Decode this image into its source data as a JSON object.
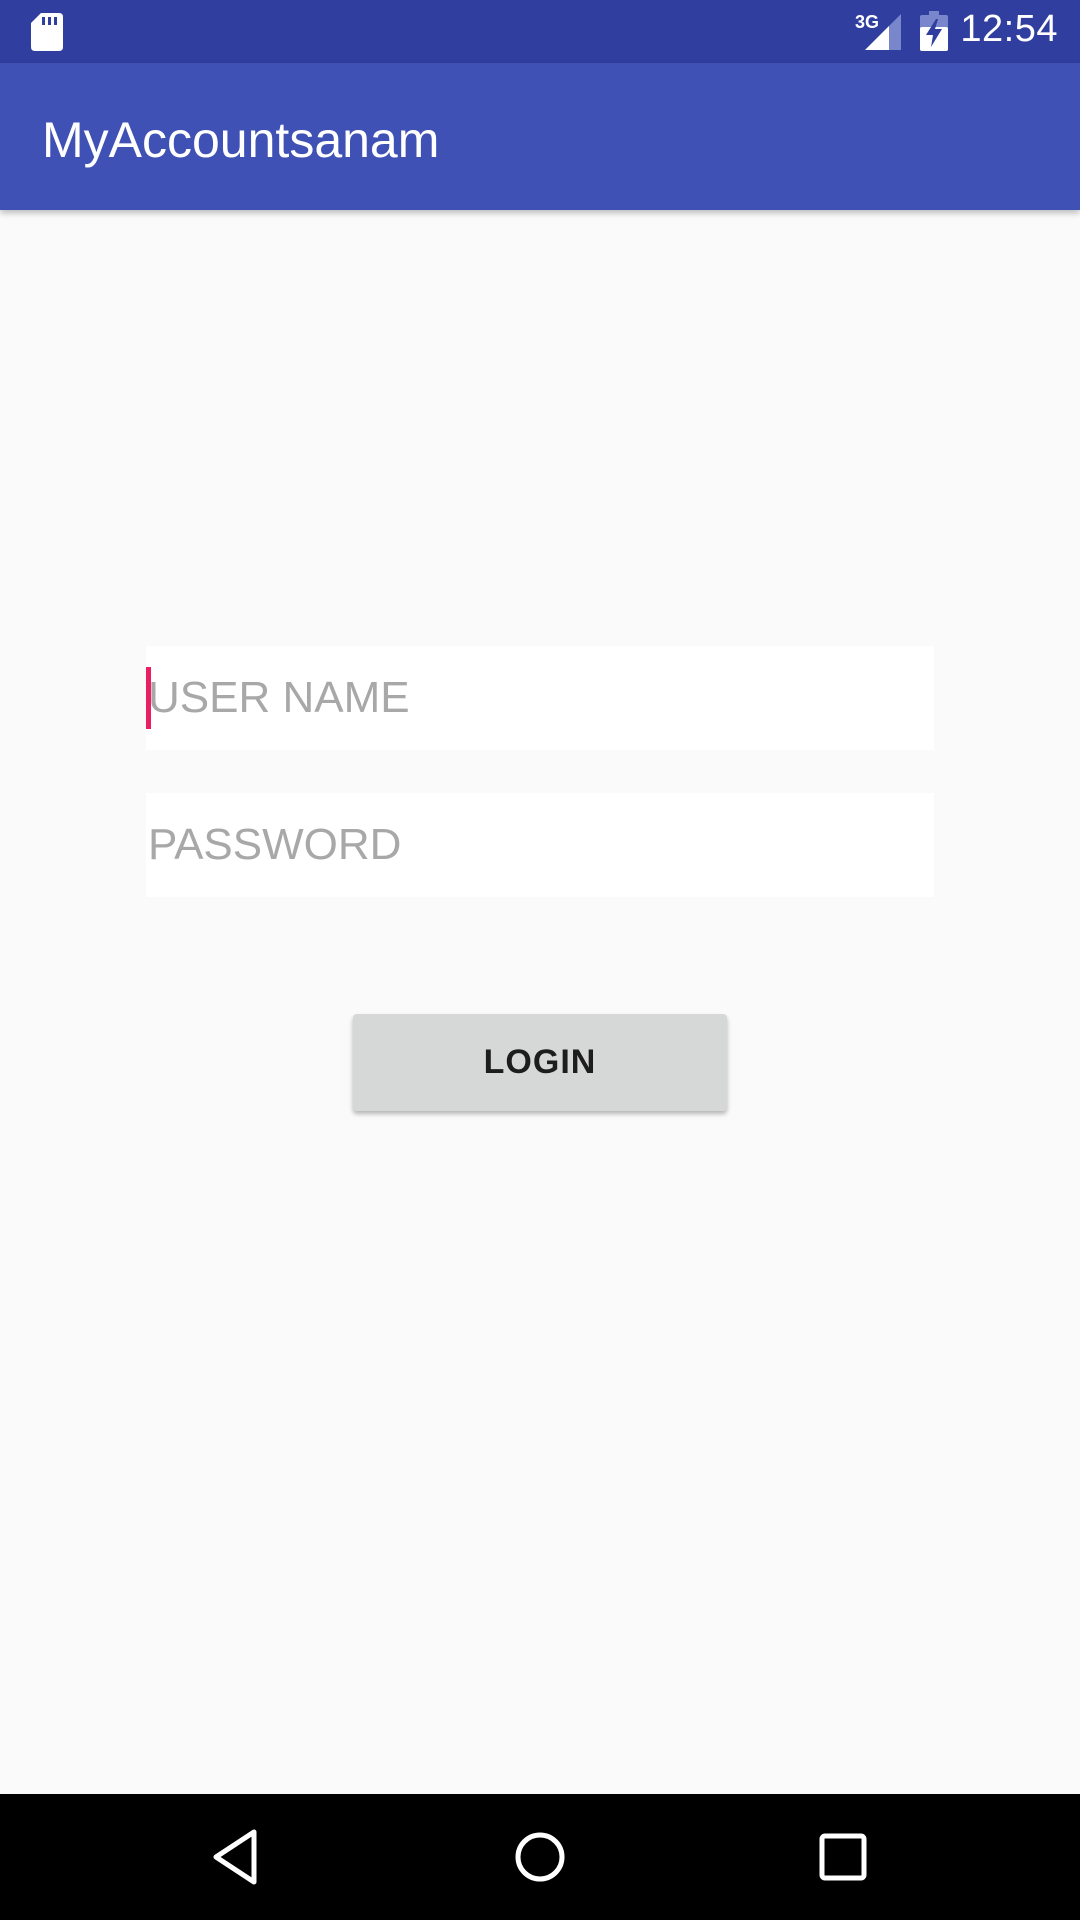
{
  "status_bar": {
    "time": "12:54",
    "network": "3G",
    "icons": [
      "sd-card-icon",
      "cellular-signal-icon",
      "battery-charging-icon"
    ]
  },
  "app_bar": {
    "title": "MyAccountsanam",
    "color": "#3f51b5",
    "status_color": "#303f9f"
  },
  "form": {
    "username_placeholder": "USER NAME",
    "password_placeholder": "PASSWORD",
    "login_label": "LOGIN",
    "cursor_color": "#e91e63"
  },
  "nav_bar": {
    "icons": [
      "back-icon",
      "home-icon",
      "recent-apps-icon"
    ]
  }
}
